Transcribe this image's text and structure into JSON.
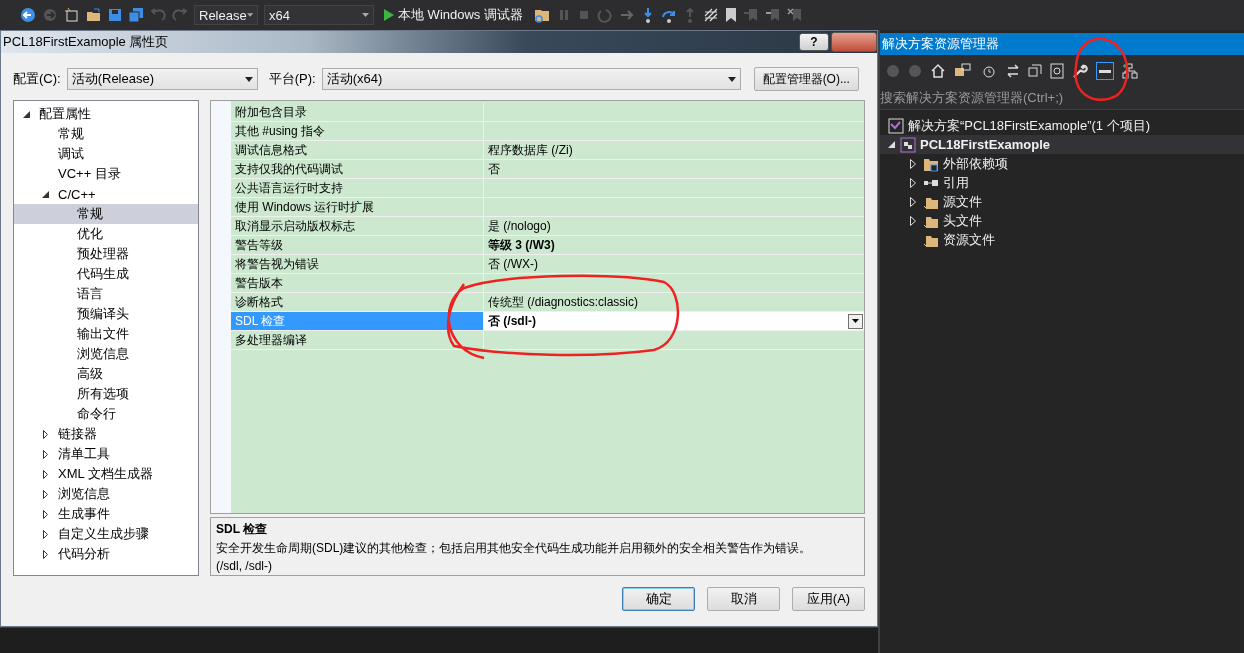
{
  "toolbar": {
    "configuration": "Release",
    "platform": "x64",
    "run_button": "本地 Windows 调试器"
  },
  "dialog": {
    "title": "PCL18FirstExamople 属性页",
    "help_button": "?",
    "config_label": "配置(C):",
    "config_value": "活动(Release)",
    "platform_label": "平台(P):",
    "platform_value": "活动(x64)",
    "manager_button": "配置管理器(O)...",
    "tree": [
      {
        "label": "配置属性",
        "expanded": true,
        "selected": false,
        "children": [
          {
            "label": "常规",
            "selected": false
          },
          {
            "label": "调试",
            "selected": false
          },
          {
            "label": "VC++ 目录",
            "selected": false
          },
          {
            "label": "C/C++",
            "expanded": true,
            "selected": false,
            "children": [
              {
                "label": "常规",
                "selected": true
              },
              {
                "label": "优化",
                "selected": false
              },
              {
                "label": "预处理器",
                "selected": false
              },
              {
                "label": "代码生成",
                "selected": false
              },
              {
                "label": "语言",
                "selected": false
              },
              {
                "label": "预编译头",
                "selected": false
              },
              {
                "label": "输出文件",
                "selected": false
              },
              {
                "label": "浏览信息",
                "selected": false
              },
              {
                "label": "高级",
                "selected": false
              },
              {
                "label": "所有选项",
                "selected": false
              },
              {
                "label": "命令行",
                "selected": false
              }
            ]
          },
          {
            "label": "链接器",
            "expanded": false,
            "selected": false
          },
          {
            "label": "清单工具",
            "expanded": false,
            "selected": false
          },
          {
            "label": "XML 文档生成器",
            "expanded": false,
            "selected": false
          },
          {
            "label": "浏览信息",
            "expanded": false,
            "selected": false
          },
          {
            "label": "生成事件",
            "expanded": false,
            "selected": false
          },
          {
            "label": "自定义生成步骤",
            "expanded": false,
            "selected": false
          },
          {
            "label": "代码分析",
            "expanded": false,
            "selected": false
          }
        ]
      }
    ],
    "properties": [
      {
        "name": "附加包含目录",
        "selected": false
      },
      {
        "name": "其他 #using 指令",
        "selected": false
      },
      {
        "name": "调试信息格式",
        "value": "程序数据库 (/Zi)",
        "bold": false,
        "selected": false
      },
      {
        "name": "支持仅我的代码调试",
        "value": "否",
        "bold": false,
        "selected": false
      },
      {
        "name": "公共语言运行时支持",
        "selected": false
      },
      {
        "name": "使用 Windows 运行时扩展",
        "selected": false
      },
      {
        "name": "取消显示启动版权标志",
        "value": "是 (/nologo)",
        "bold": false,
        "selected": false
      },
      {
        "name": "警告等级",
        "value": "等级 3 (/W3)",
        "bold": true,
        "selected": false
      },
      {
        "name": "将警告视为错误",
        "value": "否 (/WX-)",
        "bold": false,
        "selected": false
      },
      {
        "name": "警告版本",
        "selected": false
      },
      {
        "name": "诊断格式",
        "value": "传统型 (/diagnostics:classic)",
        "bold": false,
        "selected": false
      },
      {
        "name": "SDL 检查",
        "value": "否 (/sdl-)",
        "bold": true,
        "selected": true
      },
      {
        "name": "多处理器编译",
        "selected": false
      }
    ],
    "description": {
      "title": "SDL 检查",
      "text": "安全开发生命周期(SDL)建议的其他检查；包括启用其他安全代码生成功能并启用额外的安全相关警告作为错误。",
      "switches": "(/sdl, /sdl-)"
    },
    "buttons": [
      {
        "label": "确定",
        "default": true
      },
      {
        "label": "取消",
        "default": false
      },
      {
        "label": "应用(A)",
        "default": false
      }
    ]
  },
  "solution_explorer": {
    "title": "解决方案资源管理器",
    "search_placeholder": "搜索解决方案资源管理器(Ctrl+;)",
    "solution": "解决方案“PCL18FirstExamople”(1 个项目)",
    "project": {
      "label": "PCL18FirstExamople",
      "expanded": true,
      "children": [
        {
          "label": "外部依赖项",
          "kind": "external",
          "expanded": false
        },
        {
          "label": "引用",
          "kind": "references",
          "expanded": false
        },
        {
          "label": "源文件",
          "kind": "folder",
          "expanded": false
        },
        {
          "label": "头文件",
          "kind": "folder",
          "expanded": false
        },
        {
          "label": "资源文件",
          "kind": "folder"
        }
      ]
    }
  },
  "annotations": [
    {
      "kind": "freehand-circle"
    },
    {
      "kind": "freehand-circle"
    }
  ]
}
